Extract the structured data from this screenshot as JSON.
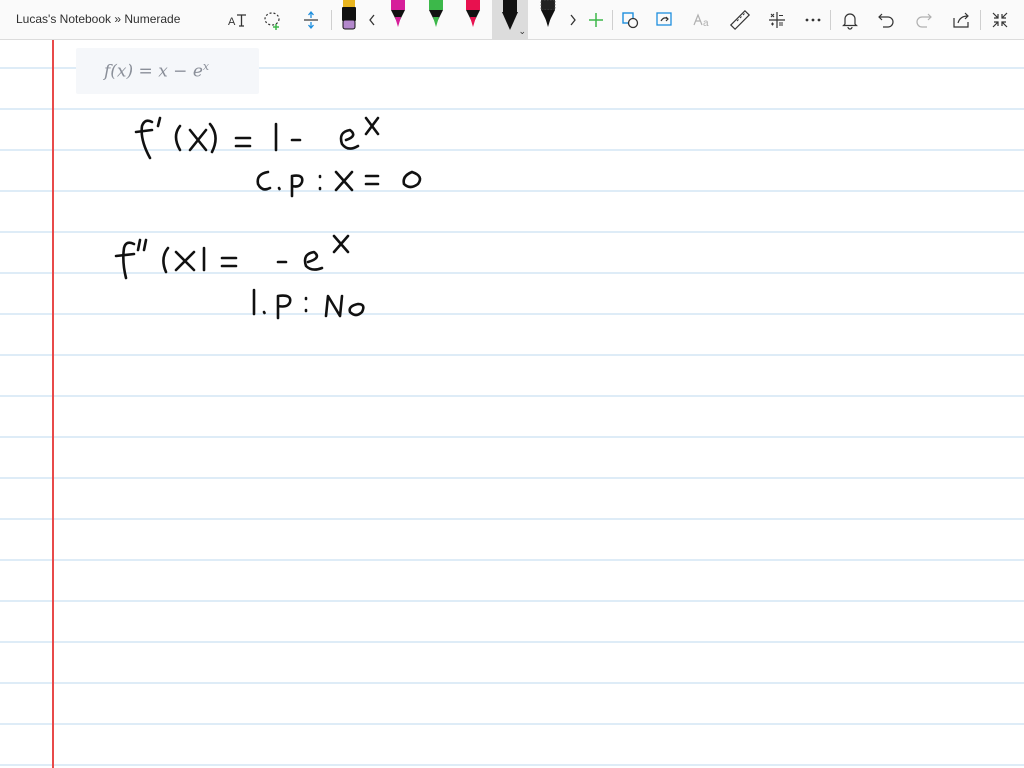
{
  "window": {
    "title": "Lucas's Notebook » Numerade"
  },
  "toolbar": {
    "tools": [
      "text-style-icon",
      "lasso-select-icon",
      "insert-space-icon",
      "highlighter-pen",
      "scroll-left-icon",
      "magenta-pen",
      "green-pen",
      "red-pen",
      "black-pen-selected",
      "black-pen",
      "scroll-right-icon",
      "add-pen-icon",
      "ink-to-shape-icon",
      "ink-replay-icon",
      "ink-to-math-icon",
      "ruler-icon",
      "math-icon",
      "more-icon",
      "notifications-icon",
      "undo-icon",
      "redo-icon",
      "share-icon",
      "fullscreen-icon"
    ],
    "colors": {
      "highlighter": "#b388cc",
      "magenta": "#d61e9a",
      "green": "#3cb84a",
      "red": "#e8114f",
      "black": "#111111",
      "accent": "#1e8fde"
    }
  },
  "page": {
    "formula": {
      "lhs": "f(x) = x − e",
      "exponent": "x"
    },
    "ink_strokes": {
      "line1": "f'(x) = 1 - e^x",
      "line2": "C.P : x = 0",
      "line3": "f''(x) = - e^x",
      "line4": "I.P : No"
    },
    "ink_color": "#111111",
    "rule_color": "#bcd8ef",
    "margin_color": "#e84a4a"
  }
}
